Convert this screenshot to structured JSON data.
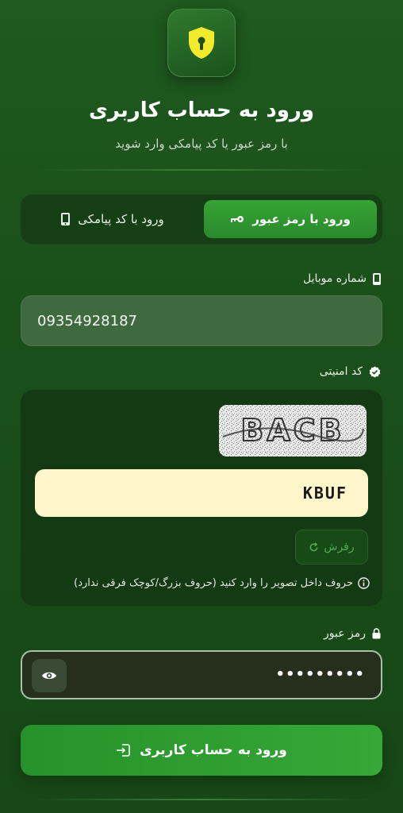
{
  "header": {
    "title": "ورود به حساب کاربری",
    "subtitle": "با رمز عبور یا کد پیامکی وارد شوید",
    "logo_icon": "shield-lock-icon"
  },
  "tabs": [
    {
      "label": "ورود با رمز عبور",
      "icon": "key-icon",
      "active": true
    },
    {
      "label": "ورود با کد پیامکی",
      "icon": "mobile-icon",
      "active": false
    }
  ],
  "mobile": {
    "label": "شماره موبایل",
    "value": "09354928187"
  },
  "captcha": {
    "label": "کد امنیتی",
    "image_text": "BACB",
    "value": "KBUF",
    "refresh_label": "رفرش",
    "hint": "حروف داخل تصویر را وارد کنید (حروف بزرگ/کوچک فرقی ندارد)"
  },
  "password": {
    "label": "رمز عبور",
    "masked_value": "•••••••••"
  },
  "submit": {
    "label": "ورود به حساب کاربری"
  },
  "colors": {
    "accent": "#2e9b30",
    "background": "#1d551d",
    "captcha_input_bg": "#fff6cc"
  }
}
